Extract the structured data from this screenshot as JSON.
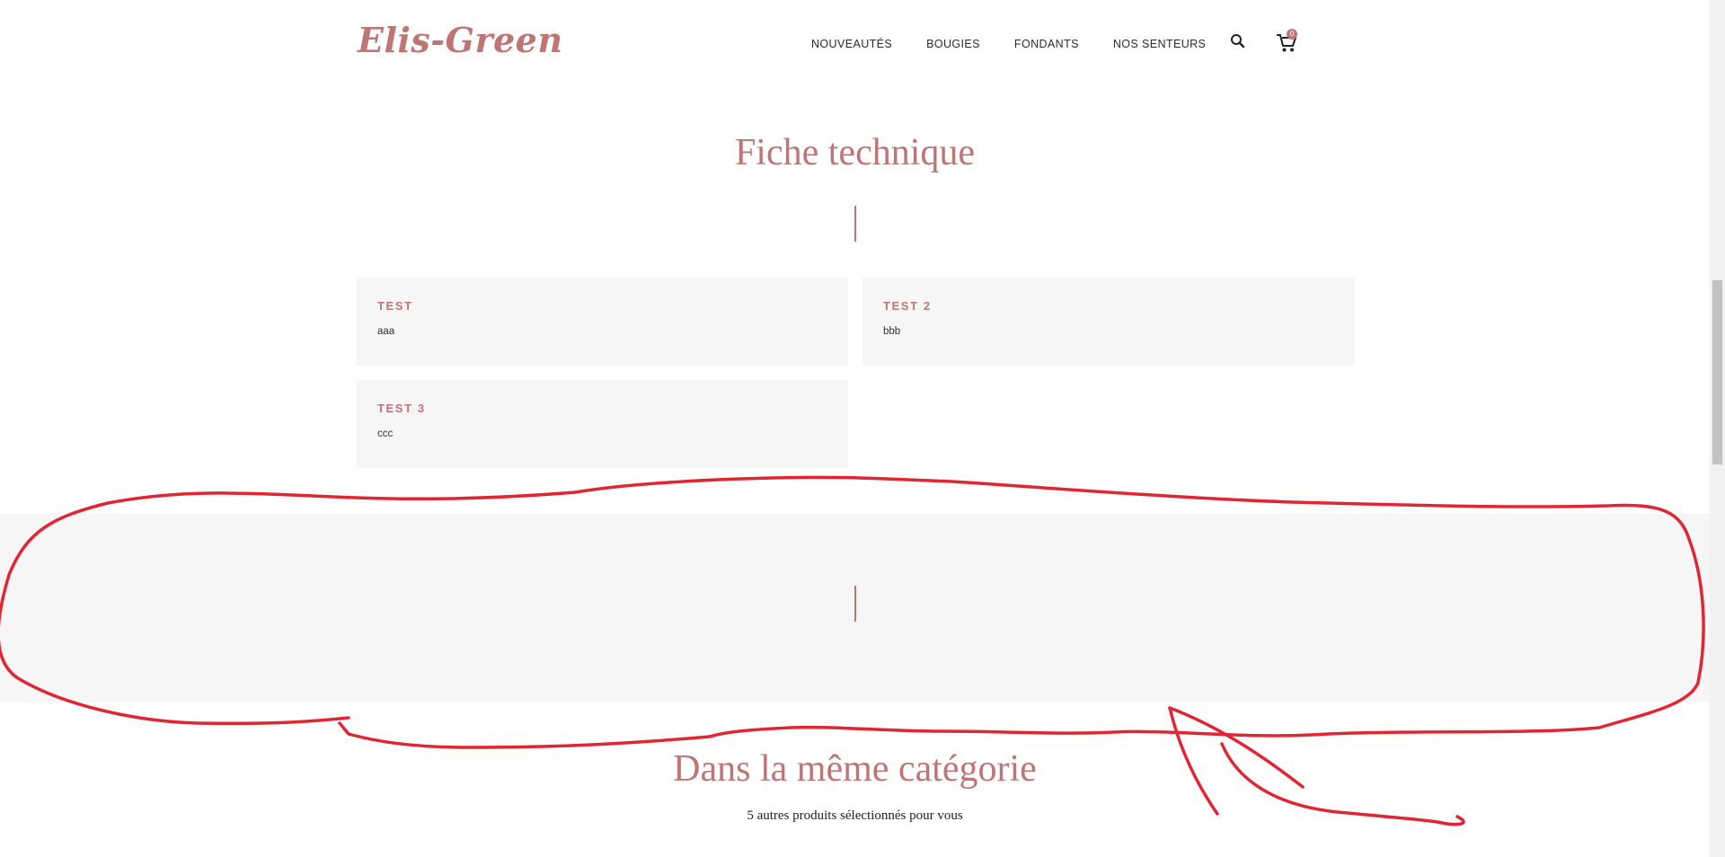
{
  "header": {
    "logo": "Elis-Green",
    "nav": [
      "NOUVEAUTÉS",
      "BOUGIES",
      "FONDANTS",
      "NOS SENTEURS"
    ],
    "cart_count": "0",
    "icons": {
      "search": "search-icon",
      "cart": "cart-icon"
    }
  },
  "fiche": {
    "title": "Fiche technique",
    "features": [
      {
        "name": "TEST",
        "value": "aaa"
      },
      {
        "name": "TEST 2",
        "value": "bbb"
      },
      {
        "name": "TEST 3",
        "value": "ccc"
      }
    ]
  },
  "category": {
    "title": "Dans la même catégorie",
    "subtitle": "5 autres produits sélectionnés pour vous"
  },
  "colors": {
    "accent": "#c07575",
    "card_bg": "#f6f6f6",
    "annotation": "#e02633"
  }
}
